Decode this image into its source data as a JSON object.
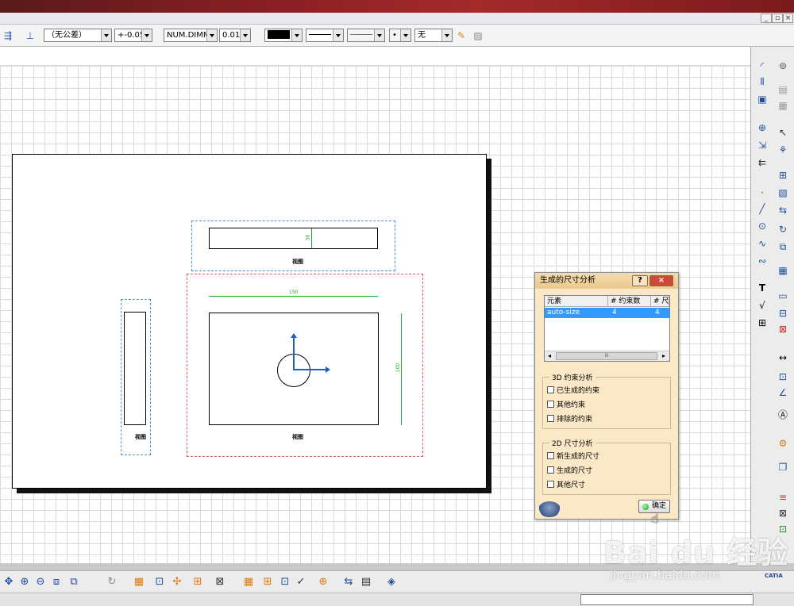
{
  "toolbar": {
    "tolerance": "（无公差）",
    "tolerance_value": "+-0.05",
    "dimension_format": "NUM.DIMM",
    "precision": "0.0100",
    "line_type": "无"
  },
  "drawing": {
    "view_label": "视图",
    "dim_top_view": "30",
    "dim_width": "150",
    "dim_height": "100"
  },
  "dialog": {
    "title": "生成的尺寸分析",
    "help": "?",
    "close": "×",
    "table": {
      "headers": [
        "元素",
        "# 约束数",
        "# 尺"
      ],
      "rows": [
        [
          "auto-size",
          "4",
          "4"
        ]
      ]
    },
    "scroll_thumb": "III",
    "group_3d": {
      "title": "3D 约束分析",
      "items": [
        "已生成的约束",
        "其他约束",
        "排除的约束"
      ]
    },
    "group_2d": {
      "title": "2D 尺寸分析",
      "items": [
        "新生成的尺寸",
        "生成的尺寸",
        "其他尺寸"
      ]
    },
    "ok": "确定"
  },
  "watermark": {
    "logo": "Bai du 经验",
    "url": "jingyan.baidu.com"
  },
  "app_logo": "CATIA",
  "colors": {
    "title_red": "#8b1f24",
    "view_blue": "#4a90e2",
    "view_red": "#e25a5a",
    "dim_green": "#22aa22",
    "axis_blue": "#1a5fd0",
    "dialog_bg": "#fbe8c6",
    "selection": "#3399ff"
  }
}
